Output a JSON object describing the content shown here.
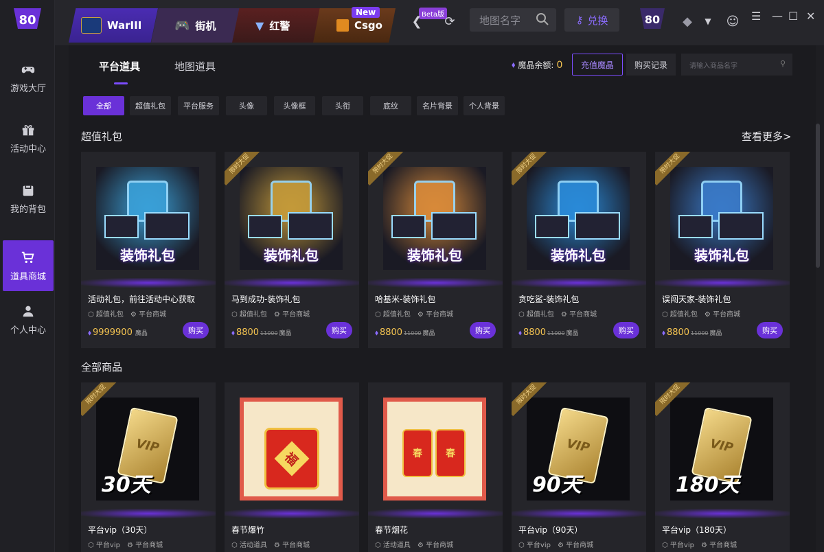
{
  "sidebar": {
    "items": [
      {
        "label": "游戏大厅",
        "icon": "gamepad-icon",
        "active": false
      },
      {
        "label": "活动中心",
        "icon": "gift-icon",
        "active": false
      },
      {
        "label": "我的背包",
        "icon": "backpack-icon",
        "active": false
      },
      {
        "label": "道具商城",
        "icon": "cart-icon",
        "active": true
      },
      {
        "label": "个人中心",
        "icon": "user-icon",
        "active": false
      }
    ]
  },
  "topbar": {
    "tabs": [
      {
        "label": "WarIII",
        "badge": ""
      },
      {
        "label": "街机",
        "badge": ""
      },
      {
        "label": "红警",
        "badge": "New"
      },
      {
        "label": "Csgo",
        "badge": "Beta版"
      }
    ],
    "search_placeholder": "地图名字",
    "redeem_label": "兑换"
  },
  "shop": {
    "subtabs": [
      "平台道具",
      "地图道具"
    ],
    "balance_label": "魔晶余额:",
    "balance_value": "0",
    "recharge_label": "充值魔晶",
    "records_label": "购买记录",
    "search_placeholder": "请输入商品名字",
    "filters": [
      "全部",
      "超值礼包",
      "平台服务",
      "头像",
      "头像框",
      "头衔",
      "底纹",
      "名片背景",
      "个人背景"
    ],
    "section1_title": "超值礼包",
    "see_more": "查看更多>",
    "section2_title": "全部商品",
    "ribbon_text": "限时大促",
    "buy_label": "购买",
    "currency": "魔晶",
    "pack_label": "装饰礼包",
    "packs": [
      {
        "name": "活动礼包，前往活动中心获取",
        "tag1": "超值礼包",
        "tag2": "平台商城",
        "price": "9999900",
        "orig": "",
        "ribbon": false,
        "color": "#3aa0d8"
      },
      {
        "name": "马到成功-装饰礼包",
        "tag1": "超值礼包",
        "tag2": "平台商城",
        "price": "8800",
        "orig": "11000",
        "ribbon": true,
        "color": "#c49a3a"
      },
      {
        "name": "哈基米-装饰礼包",
        "tag1": "超值礼包",
        "tag2": "平台商城",
        "price": "8800",
        "orig": "11000",
        "ribbon": true,
        "color": "#d88a3a"
      },
      {
        "name": "贪吃鲨-装饰礼包",
        "tag1": "超值礼包",
        "tag2": "平台商城",
        "price": "8800",
        "orig": "11000",
        "ribbon": true,
        "color": "#2a8ad8"
      },
      {
        "name": "误闯天家-装饰礼包",
        "tag1": "超值礼包",
        "tag2": "平台商城",
        "price": "8800",
        "orig": "11000",
        "ribbon": true,
        "color": "#3a7ac8"
      }
    ],
    "items": [
      {
        "name": "平台vip（30天）",
        "tag1": "平台vip",
        "tag2": "平台商城",
        "ribbon": true,
        "kind": "vip",
        "days": "30天"
      },
      {
        "name": "春节爆竹",
        "tag1": "活动道具",
        "tag2": "平台商城",
        "ribbon": false,
        "kind": "firecracker",
        "days": ""
      },
      {
        "name": "春节烟花",
        "tag1": "活动道具",
        "tag2": "平台商城",
        "ribbon": false,
        "kind": "firework",
        "days": ""
      },
      {
        "name": "平台vip（90天）",
        "tag1": "平台vip",
        "tag2": "平台商城",
        "ribbon": true,
        "kind": "vip",
        "days": "90天"
      },
      {
        "name": "平台vip（180天）",
        "tag1": "平台vip",
        "tag2": "平台商城",
        "ribbon": true,
        "kind": "vip",
        "days": "180天"
      }
    ],
    "vip_text": "VIP",
    "fu_text": "福",
    "chun_text": "春"
  },
  "colors": {
    "accent": "#6a31d8",
    "gold": "#f5c451"
  }
}
